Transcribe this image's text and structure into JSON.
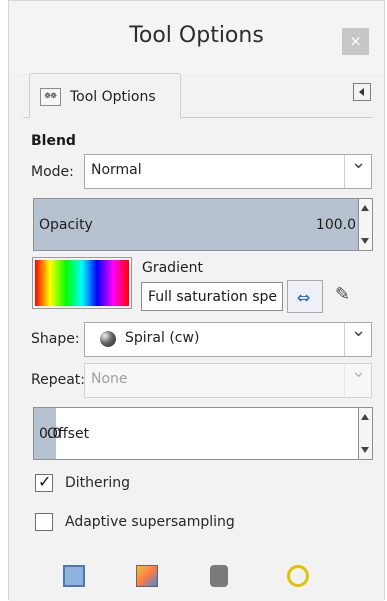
{
  "window": {
    "title": "Tool Options",
    "close_symbol": "×"
  },
  "tab": {
    "label": "Tool Options",
    "icon": "tool-options-icon",
    "icon_glyph": "☸☸"
  },
  "blend": {
    "section_label": "Blend",
    "mode_label": "Mode:",
    "mode_value": "Normal",
    "opacity_label": "Opacity",
    "opacity_value": "100.0",
    "opacity_level": 1.0,
    "gradient_label": "Gradient",
    "gradient_value": "Full saturation spe",
    "shape_label": "Shape:",
    "shape_value": "Spiral (cw)",
    "repeat_label": "Repeat:",
    "repeat_value": "None",
    "offset_label": "Offset",
    "offset_value": "0.0",
    "dithering_label": "Dithering",
    "dithering_checked": true,
    "supersampling_label": "Adaptive supersampling",
    "supersampling_checked": false
  },
  "colors": {
    "accent": "#1f5fb6",
    "spin_fill": "#b6c2cf",
    "panel_bg": "#f2f2f2"
  },
  "bottom_buttons": [
    {
      "name": "save-options-icon"
    },
    {
      "name": "restore-options-icon"
    },
    {
      "name": "delete-options-icon"
    },
    {
      "name": "reset-options-icon"
    }
  ]
}
